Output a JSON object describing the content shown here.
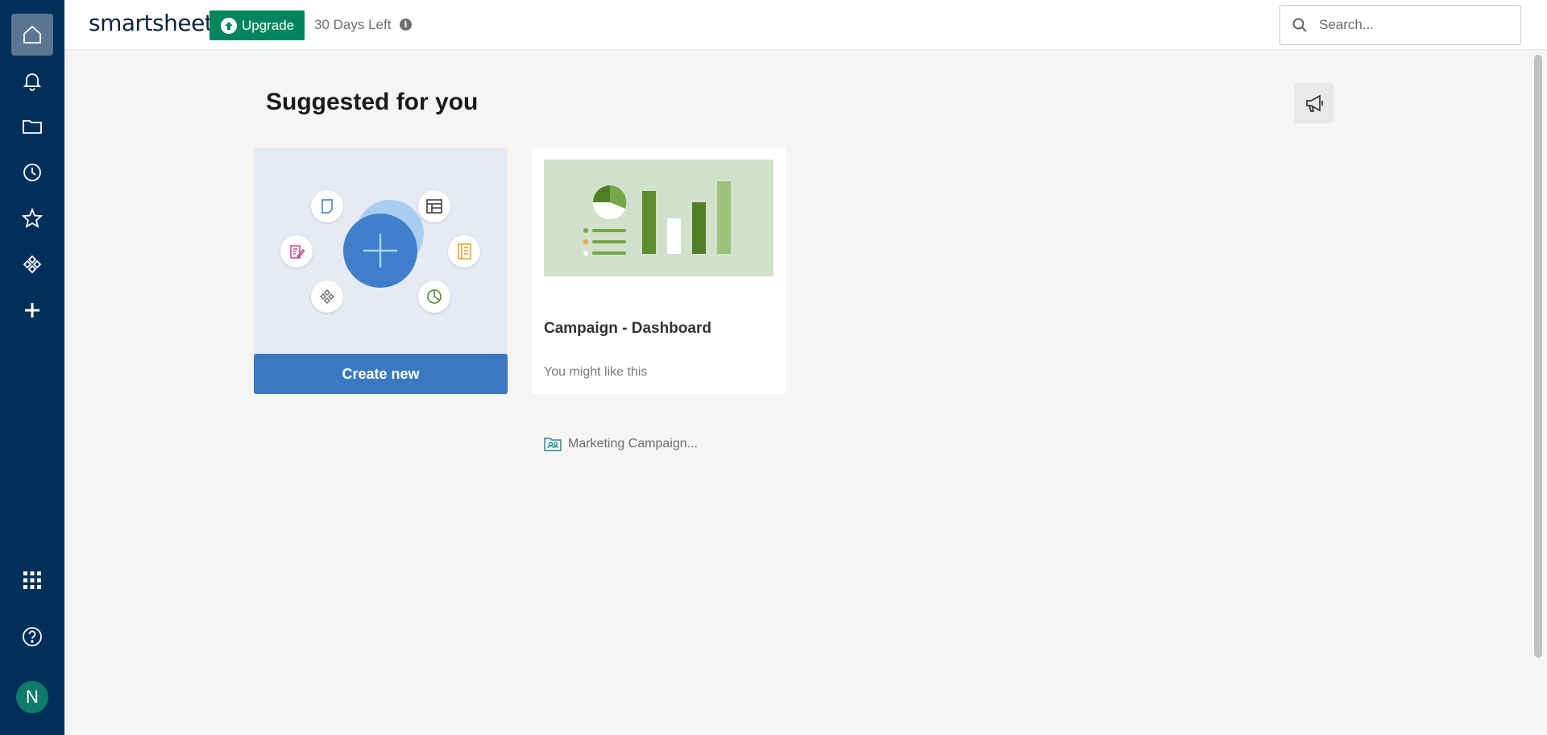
{
  "rail": {
    "items": [
      {
        "name": "home",
        "icon": "home-icon",
        "active": true
      },
      {
        "name": "notifications",
        "icon": "bell-icon"
      },
      {
        "name": "browse",
        "icon": "folder-icon"
      },
      {
        "name": "recents",
        "icon": "clock-icon"
      },
      {
        "name": "favorites",
        "icon": "star-icon"
      },
      {
        "name": "workapps",
        "icon": "workapps-icon"
      },
      {
        "name": "create",
        "icon": "plus-icon"
      },
      {
        "name": "launcher",
        "icon": "grid-icon"
      },
      {
        "name": "help",
        "icon": "help-icon"
      }
    ],
    "avatar_initial": "N",
    "colors": {
      "background": "#003059",
      "active": "#5b7693",
      "avatar": "#117b6b"
    }
  },
  "header": {
    "logo": "smartsheet",
    "upgrade_label": "Upgrade",
    "trial_text": "30 Days Left",
    "search_placeholder": "Search..."
  },
  "main": {
    "title": "Suggested for you",
    "create_card": {
      "button_label": "Create new"
    },
    "suggestions": [
      {
        "workspace": "Marketing Campaign...",
        "title": "Campaign - Dashboard",
        "subtitle": "You might like this"
      }
    ]
  },
  "colors": {
    "upgrade": "#00855c",
    "create_button": "#3a78c2",
    "page_bg": "#f6f5f3"
  }
}
